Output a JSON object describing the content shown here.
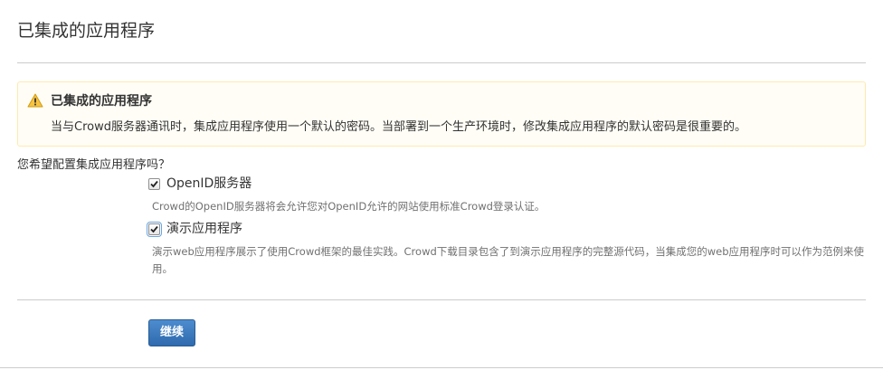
{
  "page": {
    "title": "已集成的应用程序"
  },
  "warning": {
    "title": "已集成的应用程序",
    "message": "当与Crowd服务器通讯时，集成应用程序使用一个默认的密码。当部署到一个生产环境时，修改集成应用程序的默认密码是很重要的。",
    "icon": "warning-icon",
    "accent_color": "#ffeaae"
  },
  "form": {
    "question": "您希望配置集成应用程序吗？",
    "options": [
      {
        "label": "OpenID服务器",
        "description": "Crowd的OpenID服务器将会允许您对OpenID允许的网站使用标准Crowd登录认证。",
        "checked": true
      },
      {
        "label": "演示应用程序",
        "description": "演示web应用程序展示了使用Crowd框架的最佳实践。Crowd下载目录包含了到演示应用程序的完整源代码，当集成您的web应用程序时可以作为范例来使用。",
        "checked": true
      }
    ],
    "continue_label": "继续",
    "button_color": "#3572b0"
  }
}
